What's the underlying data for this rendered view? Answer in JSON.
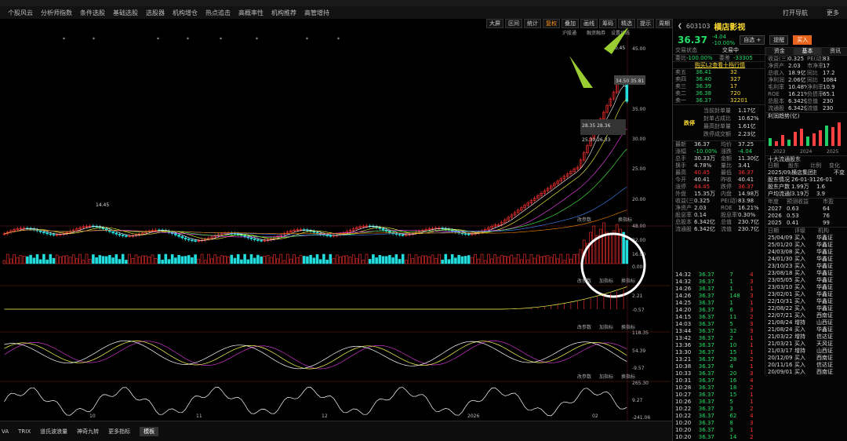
{
  "top_menu": [
    "分析师指数",
    "条件选股",
    "基础选股",
    "选股器",
    "机构增仓",
    "热点追击",
    "高概率性",
    "机构推荐",
    "高管增持"
  ],
  "top_menu_first": "个股风云",
  "top_right": [
    "打开导航",
    "更多"
  ],
  "toolbar": {
    "items": [
      "大屏",
      "区间",
      "统计",
      "叠加",
      "画线",
      "筹码",
      "精选",
      "提示",
      "周期",
      "隐藏"
    ],
    "accent": "复权"
  },
  "chart": {
    "price_ticks": [
      "45.00",
      "40.00",
      "35.00",
      "30.00",
      "25.00",
      "20.00"
    ],
    "high_label": "40.45",
    "low_label": "14.45",
    "annot_1": "34.50 35.81",
    "annot_2": "28.35 28.36",
    "annot_3": "25.30 26.33",
    "price_header": [
      "沪股通",
      "融资融券",
      "设置均线"
    ],
    "vol_header": [
      "改参数",
      "换指标"
    ],
    "vol_ticks": [
      "48.00",
      "32.00",
      "16.00",
      "0.00"
    ],
    "ind1_header": [
      "改参数",
      "加指标",
      "换指标"
    ],
    "ind1_ticks": [
      "2.21",
      "-0.57"
    ],
    "ind2_header": [
      "改参数",
      "加指标",
      "换指标"
    ],
    "ind2_ticks": [
      "118.35",
      "54.39",
      "-9.57"
    ],
    "ind3_header": [
      "改参数",
      "加指标",
      "换指标"
    ],
    "ind3_ticks": [
      "265.30",
      "9.27",
      "-241.06"
    ],
    "months": [
      "10",
      "11",
      "12",
      "2026",
      "02"
    ]
  },
  "bottom_tabs": [
    "VA",
    "TRIX",
    "道氏波浪量",
    "神奇九转",
    "更多指标"
  ],
  "bottom_active": "模板",
  "stock": {
    "code": "603103",
    "name": "横店影视",
    "price": "36.37",
    "change": "-4.04",
    "pct": "-10.00%",
    "btn_add": "自选 +",
    "btn_alert": "提醒",
    "btn_buy": "买入"
  },
  "status": {
    "label": "交易状态",
    "value": "交易中"
  },
  "wb": {
    "label": "委比",
    "pct": "-100.00%",
    "diff_label": "委差",
    "diff": "-33305"
  },
  "l2": "购买L2查看十档行情",
  "asks": [
    [
      "卖五",
      "36.41",
      "32"
    ],
    [
      "卖四",
      "36.40",
      "327"
    ],
    [
      "卖三",
      "36.39",
      "17"
    ],
    [
      "卖二",
      "36.38",
      "720"
    ],
    [
      "卖一",
      "36.37",
      "32201"
    ]
  ],
  "limit": {
    "title": "跌停",
    "rows": [
      [
        "当前封单量",
        "1.17亿"
      ],
      [
        "封单占成比",
        "10.62%"
      ],
      [
        "最高封单量",
        "1.61亿"
      ],
      [
        "跌停成交额",
        "2.23亿"
      ]
    ]
  },
  "quote": [
    [
      "最新",
      "36.37",
      "均价",
      "37.25"
    ],
    [
      "涨幅",
      "-10.00%",
      "涨跌",
      "-4.04"
    ],
    [
      "总手",
      "30.33万",
      "金额",
      "11.30亿"
    ],
    [
      "换手",
      "4.78%",
      "量比",
      "3.41"
    ],
    [
      "最高",
      "40.45",
      "最低",
      "36.37"
    ],
    [
      "今开",
      "40.41",
      "昨收",
      "40.41"
    ],
    [
      "涨停",
      "44.45",
      "跌停",
      "36.37"
    ],
    [
      "外盘",
      "15.35万",
      "内盘",
      "14.98万"
    ],
    [
      "收益(三)",
      "0.325",
      "PE(动)",
      "83.98"
    ],
    [
      "净资产",
      "2.03",
      "ROE",
      "16.21%"
    ],
    [
      "股息率",
      "0.14",
      "股息率TTM",
      "0.30%"
    ],
    [
      "总股本",
      "6.342亿",
      "总值",
      "230.7亿"
    ],
    [
      "流通股",
      "6.342亿",
      "流值",
      "230.7亿"
    ]
  ],
  "rp_tabs": [
    "资金",
    "基本",
    "资讯"
  ],
  "rp_tab_active": "基本",
  "fund": [
    [
      "收益(三)",
      "0.325"
    ],
    [
      "净资产",
      "2.03"
    ],
    [
      "总收入",
      "18.9亿"
    ],
    [
      "净利润",
      "2.06亿"
    ],
    [
      "毛利率",
      "10.48%"
    ],
    [
      "ROE",
      "16.21%"
    ],
    [
      "总股本",
      "6.342亿"
    ],
    [
      "流通股",
      "6.342亿"
    ]
  ],
  "fund2": [
    [
      "PE(动)",
      "83"
    ],
    [
      "市净率",
      "17"
    ],
    [
      "同比",
      "17.2"
    ],
    [
      "同比",
      "1084"
    ],
    [
      "净利率",
      "10.9"
    ],
    [
      "负债率",
      "65.1"
    ],
    [
      "总值",
      "230"
    ],
    [
      "流值",
      "230"
    ]
  ],
  "profit_title": "利润趋势(亿)",
  "profit_years": [
    "2023",
    "2024",
    "2025"
  ],
  "holders_title": "十大流通股东",
  "holders_cols": [
    "日期",
    "股东",
    "比例",
    "变化"
  ],
  "holders": [
    [
      "2025/09/30",
      "横店集团控股",
      "",
      "不变"
    ],
    [
      "股东情况",
      "26-01-31",
      "26-01",
      ""
    ],
    [
      "股东户数",
      "1.99万",
      "1.6",
      ""
    ],
    [
      "户均流通股",
      "3.19万",
      "3.9",
      ""
    ]
  ],
  "forecast_cols": [
    "年度",
    "预测收益",
    "市盈"
  ],
  "forecast": [
    [
      "2027",
      "0.63",
      "64"
    ],
    [
      "2026",
      "0.53",
      "76"
    ],
    [
      "2025",
      "0.41",
      "99"
    ]
  ],
  "rating_cols": [
    "日期",
    "评级",
    "机构"
  ],
  "ratings": [
    [
      "25/04/09",
      "买入",
      "华鑫证"
    ],
    [
      "25/01/20",
      "买入",
      "华鑫证"
    ],
    [
      "24/03/08",
      "买入",
      "华鑫证"
    ],
    [
      "24/01/30",
      "买入",
      "华鑫证"
    ],
    [
      "23/10/23",
      "买入",
      "华鑫证"
    ],
    [
      "23/08/18",
      "买入",
      "华鑫证"
    ],
    [
      "23/05/05",
      "买入",
      "华鑫证"
    ],
    [
      "23/03/10",
      "买入",
      "华鑫证"
    ],
    [
      "23/02/01",
      "买入",
      "华鑫证"
    ],
    [
      "22/10/31",
      "买入",
      "华鑫证"
    ],
    [
      "22/08/22",
      "买入",
      "华鑫证"
    ],
    [
      "22/07/21",
      "买入",
      "西南证"
    ],
    [
      "21/08/24",
      "增持",
      "山西证"
    ],
    [
      "21/08/24",
      "买入",
      "华鑫证"
    ],
    [
      "21/03/22",
      "增持",
      "信达证"
    ],
    [
      "21/03/21",
      "买入",
      "天风证"
    ],
    [
      "21/03/17",
      "增持",
      "山西证"
    ],
    [
      "20/12/09",
      "买入",
      "西南证"
    ],
    [
      "20/11/16",
      "买入",
      "信达证"
    ],
    [
      "20/09/01",
      "买入",
      "西南证"
    ]
  ],
  "ticks": [
    [
      "14:32",
      "36.37",
      "7",
      "4"
    ],
    [
      "14:32",
      "36.37",
      "1",
      "3"
    ],
    [
      "14:26",
      "36.37",
      "1",
      "1"
    ],
    [
      "14:26",
      "36.37",
      "148",
      "3"
    ],
    [
      "14:25",
      "36.37",
      "1",
      "1"
    ],
    [
      "14:20",
      "36.37",
      "6",
      "3"
    ],
    [
      "14:15",
      "36.37",
      "11",
      "2"
    ],
    [
      "14:03",
      "36.37",
      "5",
      "3"
    ],
    [
      "13:44",
      "36.37",
      "32",
      "3"
    ],
    [
      "13:42",
      "36.37",
      "2",
      "1"
    ],
    [
      "13:36",
      "36.37",
      "10",
      "1"
    ],
    [
      "13:30",
      "36.37",
      "15",
      "1"
    ],
    [
      "13:21",
      "36.37",
      "28",
      "2"
    ],
    [
      "10:38",
      "36.37",
      "4",
      "1"
    ],
    [
      "10:33",
      "36.37",
      "20",
      "3"
    ],
    [
      "10:31",
      "36.37",
      "16",
      "4"
    ],
    [
      "10:28",
      "36.37",
      "18",
      "2"
    ],
    [
      "10:27",
      "36.37",
      "15",
      "1"
    ],
    [
      "10:26",
      "36.37",
      "5",
      "1"
    ],
    [
      "10:22",
      "36.37",
      "3",
      "2"
    ],
    [
      "10:22",
      "36.37",
      "62",
      "4"
    ],
    [
      "10:20",
      "36.37",
      "8",
      "3"
    ],
    [
      "10:20",
      "36.37",
      "3",
      "1"
    ],
    [
      "10:20",
      "36.37",
      "14",
      "2"
    ]
  ],
  "colors": {
    "up": "#ff3333",
    "down": "#22dddd",
    "accent": "#ff9020",
    "name": "#ffdd33"
  }
}
